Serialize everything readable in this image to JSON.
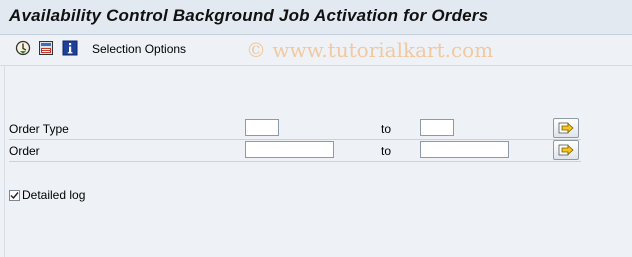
{
  "window": {
    "title": "Availability Control Background Job Activation for Orders"
  },
  "toolbar": {
    "icons": [
      "execute-icon",
      "save-variant-icon",
      "info-icon"
    ],
    "selection_options_label": "Selection Options",
    "watermark": "© www.tutorialkart.com"
  },
  "form": {
    "rows": [
      {
        "label": "Order Type",
        "to_label": "to",
        "from_value": "",
        "to_value": ""
      },
      {
        "label": "Order",
        "to_label": "to",
        "from_value": "",
        "to_value": ""
      }
    ],
    "checkbox": {
      "label": "Detailed log",
      "checked": true
    }
  }
}
